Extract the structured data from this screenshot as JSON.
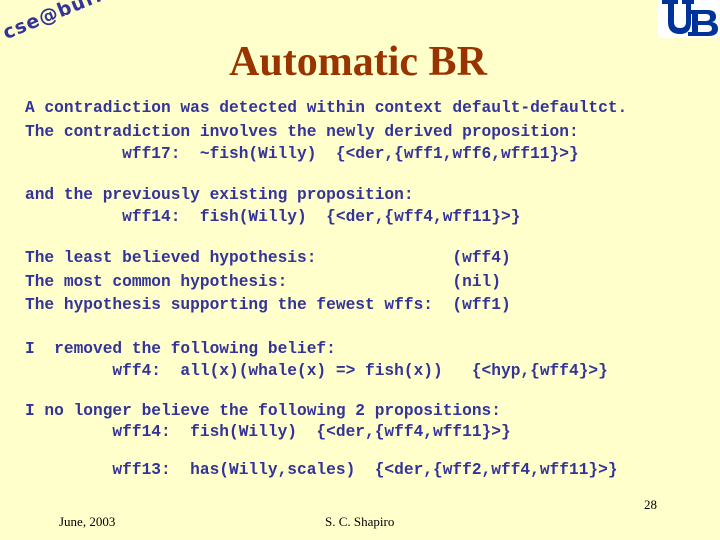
{
  "header": {
    "logo_text": "cse@buffalo",
    "title": "Automatic BR"
  },
  "colors": {
    "background": "#ffffcc",
    "title": "#993300",
    "body_text": "#333399",
    "ub_logo": "#003399"
  },
  "body": {
    "lines": [
      "A contradiction was detected within context default-defaultct.",
      "The contradiction involves the newly derived proposition:",
      "          wff17:  ~fish(Willy)  {<der,{wff1,wff6,wff11}>}",
      "and the previously existing proposition:",
      "          wff14:  fish(Willy)  {<der,{wff4,wff11}>}",
      "The least believed hypothesis:              (wff4)",
      "The most common hypothesis:                 (nil)",
      "The hypothesis supporting the fewest wffs:  (wff1)",
      "I  removed the following belief:",
      "         wff4:  all(x)(whale(x) => fish(x))   {<hyp,{wff4}>}",
      "I no longer believe the following 2 propositions:",
      "         wff14:  fish(Willy)  {<der,{wff4,wff11}>}",
      "         wff13:  has(Willy,scales)  {<der,{wff2,wff4,wff11}>}"
    ]
  },
  "footer": {
    "date": "June, 2003",
    "author": "S. C. Shapiro",
    "page_number": "28"
  }
}
